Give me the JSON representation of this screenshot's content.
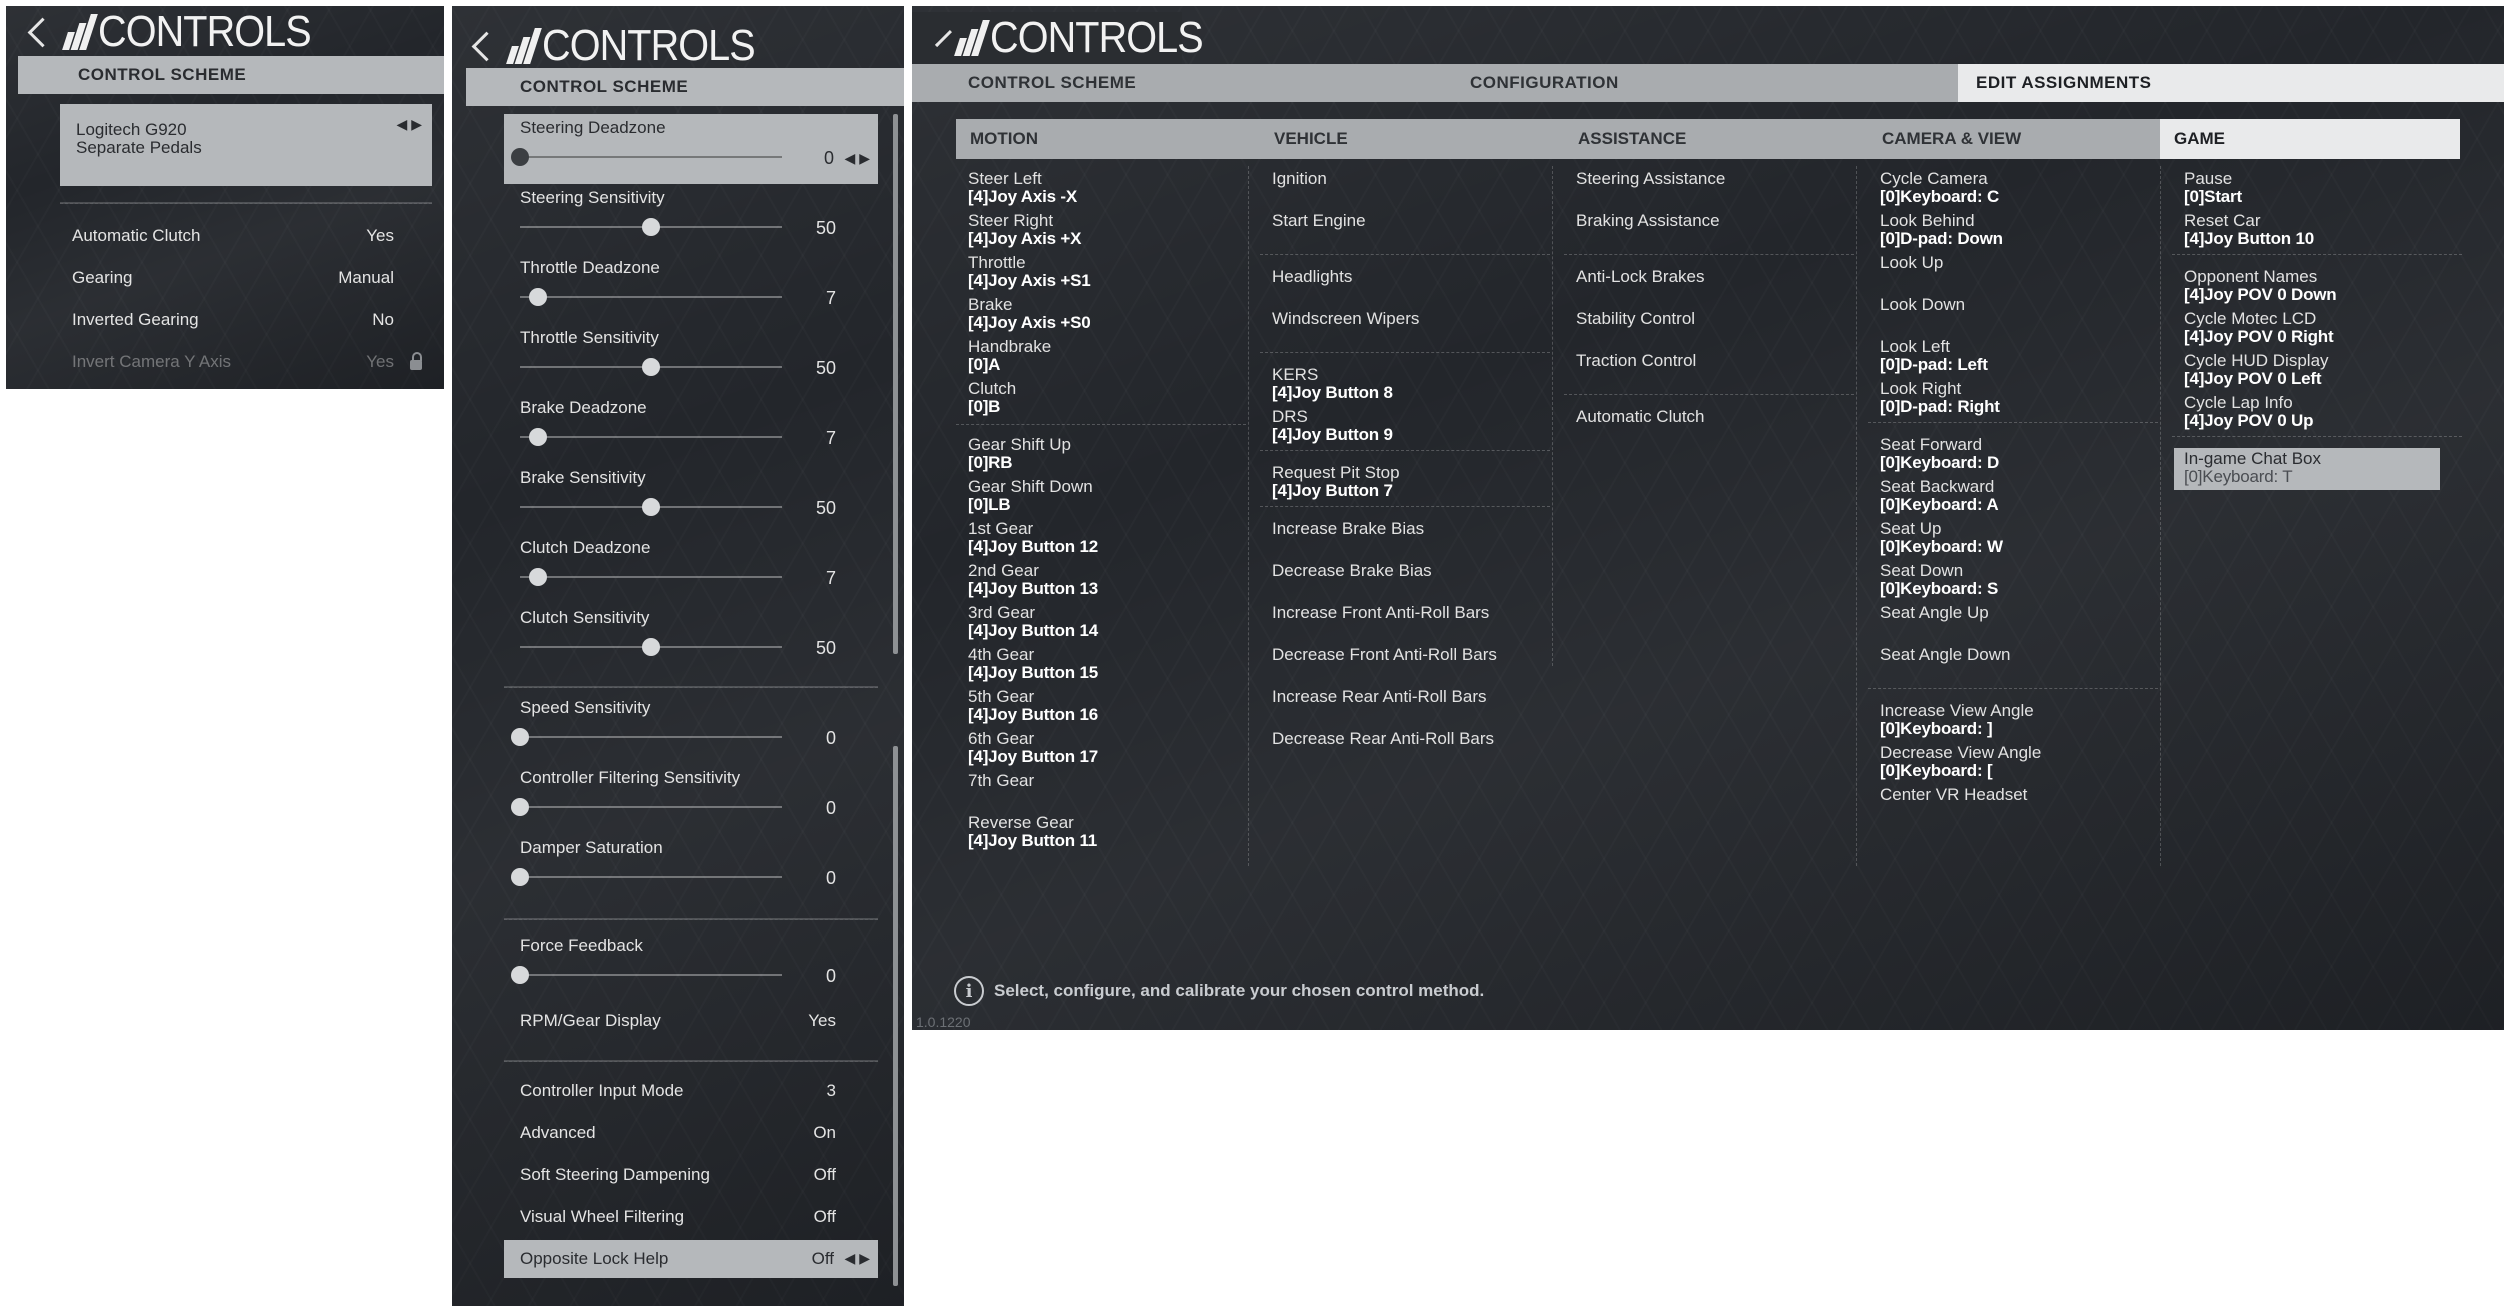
{
  "header": {
    "title": "CONTROLS"
  },
  "panel1": {
    "section": "CONTROL SCHEME",
    "device_line1": "Logitech G920",
    "device_line2": "Separate Pedals",
    "rows": [
      {
        "label": "Automatic Clutch",
        "value": "Yes"
      },
      {
        "label": "Gearing",
        "value": "Manual"
      },
      {
        "label": "Inverted Gearing",
        "value": "No"
      },
      {
        "label": "Invert Camera Y Axis",
        "value": "Yes"
      }
    ]
  },
  "panel2": {
    "section": "CONTROL SCHEME",
    "sliders": [
      {
        "label": "Steering Deadzone",
        "value": "0",
        "level": 0
      },
      {
        "label": "Steering Sensitivity",
        "value": "50",
        "level": 0.5
      },
      {
        "label": "Throttle Deadzone",
        "value": "7",
        "level": 0.07
      },
      {
        "label": "Throttle Sensitivity",
        "value": "50",
        "level": 0.5
      },
      {
        "label": "Brake Deadzone",
        "value": "7",
        "level": 0.07
      },
      {
        "label": "Brake Sensitivity",
        "value": "50",
        "level": 0.5
      },
      {
        "label": "Clutch Deadzone",
        "value": "7",
        "level": 0.07
      },
      {
        "label": "Clutch Sensitivity",
        "value": "50",
        "level": 0.5
      },
      {
        "label": "Speed Sensitivity",
        "value": "0",
        "level": 0
      },
      {
        "label": "Controller Filtering Sensitivity",
        "value": "0",
        "level": 0
      },
      {
        "label": "Damper Saturation",
        "value": "0",
        "level": 0
      },
      {
        "label": "Force Feedback",
        "value": "0",
        "level": 0
      }
    ],
    "options": [
      {
        "label": "RPM/Gear Display",
        "value": "Yes"
      },
      {
        "label": "Controller Input Mode",
        "value": "3"
      },
      {
        "label": "Advanced",
        "value": "On"
      },
      {
        "label": "Soft Steering Dampening",
        "value": "Off"
      },
      {
        "label": "Visual Wheel Filtering",
        "value": "Off"
      },
      {
        "label": "Opposite Lock Help",
        "value": "Off"
      }
    ]
  },
  "panel3": {
    "tabs": [
      "CONTROL SCHEME",
      "CONFIGURATION",
      "EDIT ASSIGNMENTS"
    ],
    "columns": [
      "MOTION",
      "VEHICLE",
      "ASSISTANCE",
      "CAMERA & VIEW",
      "GAME"
    ],
    "motion": [
      {
        "name": "Steer Left",
        "binding": "[4]Joy Axis -X"
      },
      {
        "name": "Steer Right",
        "binding": "[4]Joy Axis +X"
      },
      {
        "name": "Throttle",
        "binding": "[4]Joy Axis +S1"
      },
      {
        "name": "Brake",
        "binding": "[4]Joy Axis +S0"
      },
      {
        "name": "Handbrake",
        "binding": "[0]A"
      },
      {
        "name": "Clutch",
        "binding": "[0]B"
      },
      {
        "name": "Gear Shift Up",
        "binding": "[0]RB"
      },
      {
        "name": "Gear Shift Down",
        "binding": "[0]LB"
      },
      {
        "name": "1st Gear",
        "binding": "[4]Joy Button 12"
      },
      {
        "name": "2nd Gear",
        "binding": "[4]Joy Button 13"
      },
      {
        "name": "3rd Gear",
        "binding": "[4]Joy Button 14"
      },
      {
        "name": "4th Gear",
        "binding": "[4]Joy Button 15"
      },
      {
        "name": "5th Gear",
        "binding": "[4]Joy Button 16"
      },
      {
        "name": "6th Gear",
        "binding": "[4]Joy Button 17"
      },
      {
        "name": "7th Gear",
        "binding": ""
      },
      {
        "name": "Reverse Gear",
        "binding": "[4]Joy Button 11"
      }
    ],
    "vehicle": [
      {
        "name": "Ignition",
        "binding": ""
      },
      {
        "name": "Start Engine",
        "binding": ""
      },
      {
        "name": "Headlights",
        "binding": ""
      },
      {
        "name": "Windscreen Wipers",
        "binding": ""
      },
      {
        "name": "KERS",
        "binding": "[4]Joy Button 8"
      },
      {
        "name": "DRS",
        "binding": "[4]Joy Button 9"
      },
      {
        "name": "Request Pit Stop",
        "binding": "[4]Joy Button 7"
      },
      {
        "name": "Increase Brake Bias",
        "binding": ""
      },
      {
        "name": "Decrease Brake Bias",
        "binding": ""
      },
      {
        "name": "Increase Front Anti-Roll Bars",
        "binding": ""
      },
      {
        "name": "Decrease Front Anti-Roll Bars",
        "binding": ""
      },
      {
        "name": "Increase Rear Anti-Roll Bars",
        "binding": ""
      },
      {
        "name": "Decrease Rear Anti-Roll Bars",
        "binding": ""
      }
    ],
    "assistance": [
      {
        "name": "Steering Assistance",
        "binding": ""
      },
      {
        "name": "Braking Assistance",
        "binding": ""
      },
      {
        "name": "Anti-Lock Brakes",
        "binding": ""
      },
      {
        "name": "Stability Control",
        "binding": ""
      },
      {
        "name": "Traction Control",
        "binding": ""
      },
      {
        "name": "Automatic Clutch",
        "binding": ""
      }
    ],
    "camera": [
      {
        "name": "Cycle Camera",
        "binding": "[0]Keyboard: C"
      },
      {
        "name": "Look Behind",
        "binding": "[0]D-pad: Down"
      },
      {
        "name": "Look Up",
        "binding": ""
      },
      {
        "name": "Look Down",
        "binding": ""
      },
      {
        "name": "Look Left",
        "binding": "[0]D-pad: Left"
      },
      {
        "name": "Look Right",
        "binding": "[0]D-pad: Right"
      },
      {
        "name": "Seat Forward",
        "binding": "[0]Keyboard: D"
      },
      {
        "name": "Seat Backward",
        "binding": "[0]Keyboard: A"
      },
      {
        "name": "Seat Up",
        "binding": "[0]Keyboard: W"
      },
      {
        "name": "Seat Down",
        "binding": "[0]Keyboard: S"
      },
      {
        "name": "Seat Angle Up",
        "binding": ""
      },
      {
        "name": "Seat Angle Down",
        "binding": ""
      },
      {
        "name": "Increase View Angle",
        "binding": "[0]Keyboard: ]"
      },
      {
        "name": "Decrease View Angle",
        "binding": "[0]Keyboard: ["
      },
      {
        "name": "Center VR Headset",
        "binding": ""
      }
    ],
    "game": [
      {
        "name": "Pause",
        "binding": "[0]Start"
      },
      {
        "name": "Reset Car",
        "binding": "[4]Joy Button 10"
      },
      {
        "name": "Opponent Names",
        "binding": "[4]Joy POV 0 Down"
      },
      {
        "name": "Cycle Motec LCD",
        "binding": "[4]Joy POV 0 Right"
      },
      {
        "name": "Cycle HUD Display",
        "binding": "[4]Joy POV 0 Left"
      },
      {
        "name": "Cycle Lap Info",
        "binding": "[4]Joy POV 0 Up"
      },
      {
        "name": "In-game Chat Box",
        "binding": "[0]Keyboard: T"
      }
    ],
    "hint": "Select, configure, and calibrate your chosen control method.",
    "version": "1.0.1220"
  }
}
